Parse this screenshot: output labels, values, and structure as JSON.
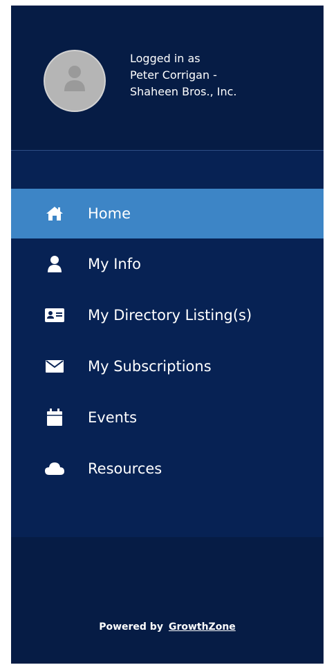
{
  "user": {
    "logged_in_label": "Logged in as",
    "name_line": "Peter Corrigan -",
    "company_line": "Shaheen Bros., Inc."
  },
  "nav": {
    "items": [
      {
        "label": "Home",
        "icon": "home-icon",
        "active": true
      },
      {
        "label": "My Info",
        "icon": "user-icon",
        "active": false
      },
      {
        "label": "My Directory Listing(s)",
        "icon": "id-card-icon",
        "active": false
      },
      {
        "label": "My Subscriptions",
        "icon": "envelope-icon",
        "active": false
      },
      {
        "label": "Events",
        "icon": "calendar-icon",
        "active": false
      },
      {
        "label": "Resources",
        "icon": "cloud-icon",
        "active": false
      }
    ]
  },
  "footer": {
    "powered_by": "Powered by",
    "brand_link": "GrowthZone"
  },
  "colors": {
    "background": "#072254",
    "header_background": "#061c45",
    "active_item": "#3d85c6",
    "text": "#ffffff"
  }
}
